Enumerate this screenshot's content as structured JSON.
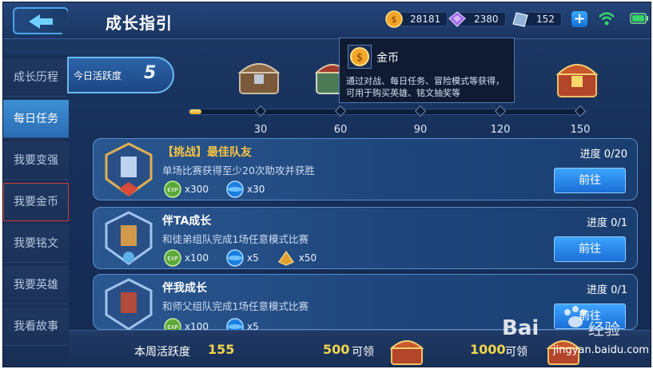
{
  "header": {
    "title": "成长指引",
    "gold": "28181",
    "diamonds": "2380",
    "vouchers": "152",
    "plus": "+"
  },
  "sidebar": {
    "items": [
      {
        "label": "成长历程"
      },
      {
        "label": "每日任务"
      },
      {
        "label": "我要变强"
      },
      {
        "label": "我要金币"
      },
      {
        "label": "我要铭文"
      },
      {
        "label": "我要英雄"
      },
      {
        "label": "我看故事"
      }
    ]
  },
  "activity": {
    "label": "今日活跃度",
    "value": "5"
  },
  "progress": {
    "milestones": [
      "30",
      "60",
      "90",
      "120",
      "150"
    ],
    "current_fraction": 0.03
  },
  "tooltip": {
    "title": "金币",
    "desc": "通过对战、每日任务、冒险模式等获得，可用于购买英雄、铭文抽奖等"
  },
  "tasks": [
    {
      "title": "【挑战】最佳队友",
      "desc": "单场比赛获得至少20次助攻并获胜",
      "progress": "进度 0/20",
      "button": "前往",
      "rewards": [
        {
          "icon": "exp-icon",
          "amount": "x300"
        },
        {
          "icon": "blue-orb-icon",
          "amount": "x30"
        }
      ]
    },
    {
      "title": "伴TA成长",
      "desc": "和徒弟组队完成1场任意模式比赛",
      "progress": "进度 0/1",
      "button": "前往",
      "rewards": [
        {
          "icon": "exp-icon",
          "amount": "x100"
        },
        {
          "icon": "blue-orb-icon",
          "amount": "x5"
        },
        {
          "icon": "gold-ingot-icon",
          "amount": "x50"
        }
      ]
    },
    {
      "title": "伴我成长",
      "desc": "和师父组队完成1场任意模式比赛",
      "progress": "进度 0/1",
      "button": "前往",
      "rewards": [
        {
          "icon": "exp-icon",
          "amount": "x100"
        },
        {
          "icon": "blue-orb-icon",
          "amount": "x5"
        }
      ]
    }
  ],
  "bottom": {
    "weekly_label": "本周活跃度",
    "weekly_value": "155",
    "reward1_num": "500",
    "reward1_label": "可领",
    "reward2_num": "1000",
    "reward2_label": "可领"
  },
  "watermark": {
    "text": "jingyan.baidu.com"
  },
  "colors": {
    "accent": "#3ca4ff",
    "gold_text": "#f1d64a",
    "challenge_title": "#f6c243"
  }
}
